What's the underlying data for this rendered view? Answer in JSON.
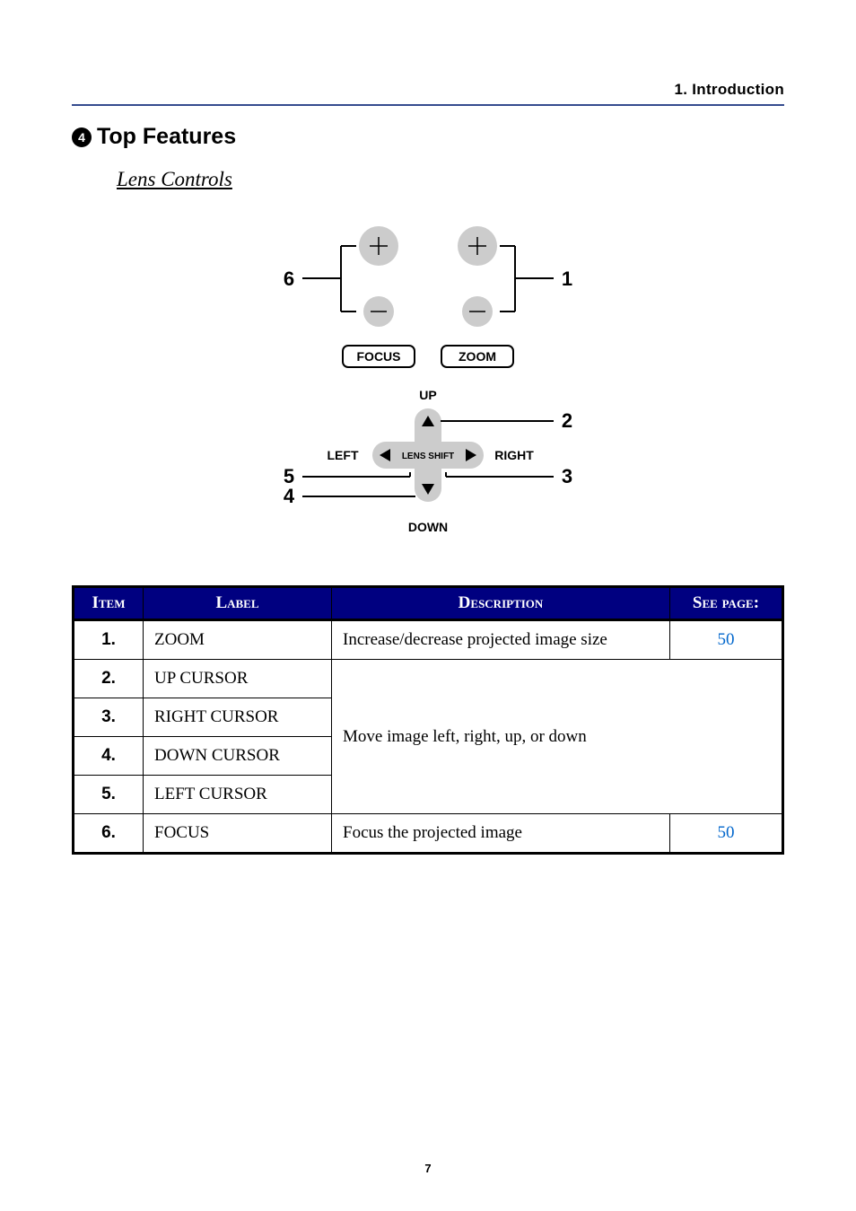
{
  "chapter": "1. Introduction",
  "heading_number": "4",
  "heading_text": "Top Features",
  "subheading": "Lens Controls",
  "diagram": {
    "focus_label": "FOCUS",
    "zoom_label": "ZOOM",
    "up": "UP",
    "down": "DOWN",
    "left": "LEFT",
    "right": "RIGHT",
    "lens_shift": "LENS SHIFT",
    "callouts": {
      "c1": "1",
      "c2": "2",
      "c3": "3",
      "c4": "4",
      "c5": "5",
      "c6": "6"
    }
  },
  "table": {
    "headers": {
      "item": "Item",
      "label": "Label",
      "description": "Description",
      "see_page": "See page:"
    },
    "rows": [
      {
        "n": "1.",
        "label": "ZOOM",
        "desc": "Increase/decrease projected image size",
        "page": "50"
      },
      {
        "n": "2.",
        "label": "UP CURSOR"
      },
      {
        "n": "3.",
        "label": "RIGHT CURSOR"
      },
      {
        "n": "4.",
        "label": "DOWN CURSOR"
      },
      {
        "n": "5.",
        "label": "LEFT CURSOR"
      },
      {
        "n": "6.",
        "label": "FOCUS",
        "desc": "Focus the projected image",
        "page": "50"
      }
    ],
    "merged_desc": "Move image left, right, up, or down"
  },
  "page_number": "7"
}
